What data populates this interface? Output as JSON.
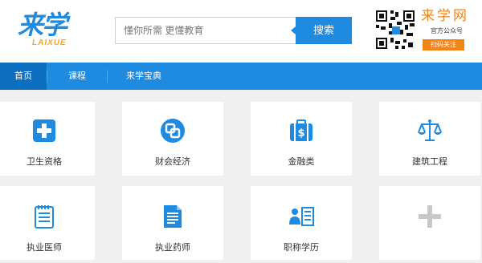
{
  "header": {
    "logo_main": "来学",
    "logo_sub": "LAIXUE",
    "search_placeholder": "懂你所需 更懂教育",
    "search_button": "搜索",
    "brand_name": "来学网",
    "brand_sub": "官方公众号",
    "brand_button": "扫码关注"
  },
  "nav": {
    "items": [
      {
        "label": "首页",
        "active": true
      },
      {
        "label": "课程",
        "active": false
      },
      {
        "label": "来学宝典",
        "active": false
      }
    ]
  },
  "categories": [
    {
      "label": "卫生资格",
      "icon": "medical-cross-icon"
    },
    {
      "label": "财会经济",
      "icon": "finance-coins-icon"
    },
    {
      "label": "金融类",
      "icon": "briefcase-money-icon"
    },
    {
      "label": "建筑工程",
      "icon": "scales-icon"
    },
    {
      "label": "执业医师",
      "icon": "clipboard-icon"
    },
    {
      "label": "执业药师",
      "icon": "document-icon"
    },
    {
      "label": "职称学历",
      "icon": "id-card-icon"
    },
    {
      "label": "",
      "icon": "add-more-icon"
    }
  ],
  "colors": {
    "primary": "#1e8ae0",
    "primary_dark": "#0d6fc2",
    "accent": "#f08519",
    "logo_accent": "#f5a623",
    "background": "#f0f0f0"
  }
}
